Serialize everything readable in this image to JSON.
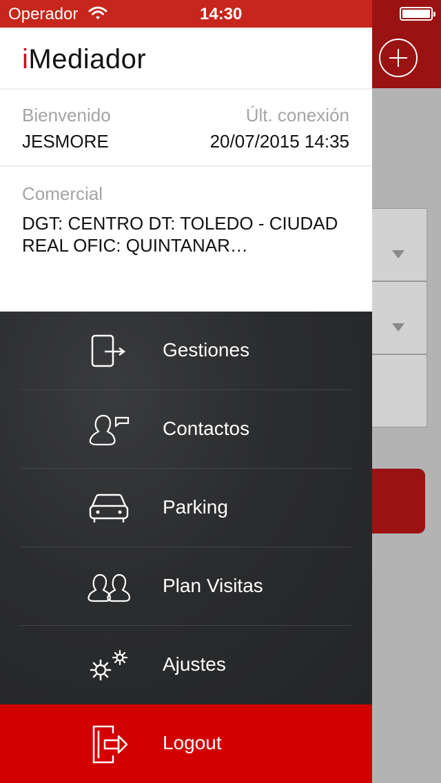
{
  "status_bar": {
    "carrier": "Operador",
    "time": "14:30"
  },
  "app": {
    "title_accent": "i",
    "title_rest": "Mediador"
  },
  "session": {
    "welcome_label": "Bienvenido",
    "user": "JESMORE",
    "last_login_label": "Últ. conexión",
    "last_login_value": "20/07/2015 14:35"
  },
  "commercial": {
    "label": "Comercial",
    "value": "DGT: CENTRO DT: TOLEDO - CIUDAD REAL OFIC: QUINTANAR…"
  },
  "menu": {
    "items": [
      {
        "label": "Gestiones",
        "icon": "gestiones-icon"
      },
      {
        "label": "Contactos",
        "icon": "contactos-icon"
      },
      {
        "label": "Parking",
        "icon": "parking-car-icon"
      },
      {
        "label": "Plan Visitas",
        "icon": "plan-visitas-icon"
      },
      {
        "label": "Ajustes",
        "icon": "ajustes-gears-icon"
      }
    ],
    "logout": {
      "label": "Logout",
      "icon": "logout-icon"
    }
  },
  "colors": {
    "brand_red": "#d20000",
    "status_bar_red": "#c6261c",
    "menu_dark": "#2b2c2e"
  }
}
